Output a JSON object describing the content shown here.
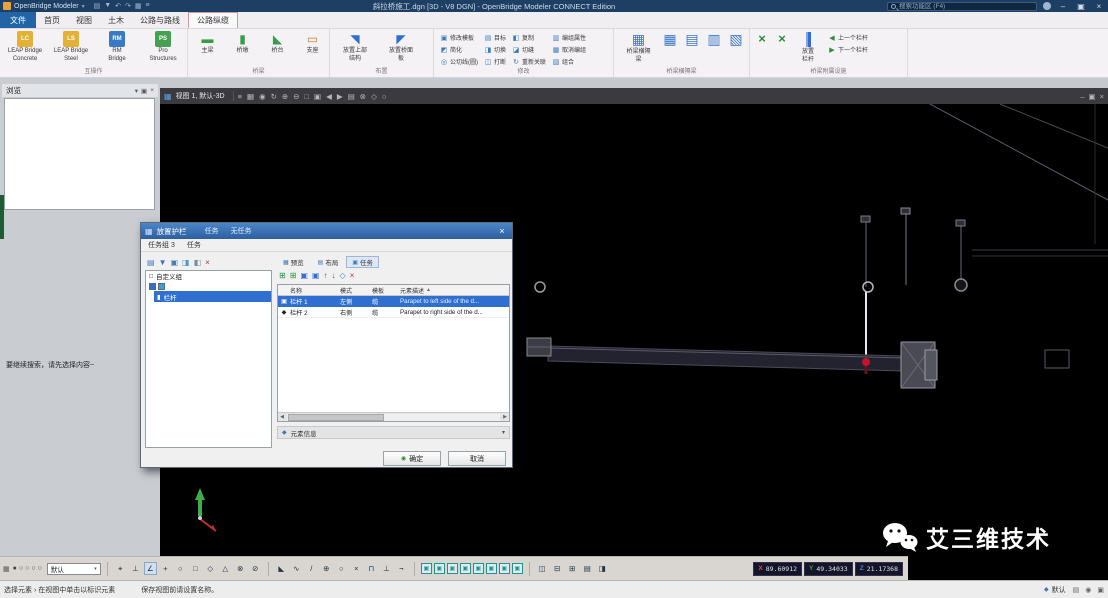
{
  "colors": {
    "titlebar": "#1d3f63",
    "selection": "#2e6fd0",
    "red_dot": "#c41228"
  },
  "titlebar": {
    "app_menu": "OpenBridge Modeler",
    "caret": "▾",
    "quick_icons": [
      "▤",
      "▼",
      "↶",
      "↷",
      "▦",
      "≡"
    ],
    "title": "斜拉桥施工.dgn [3D - V8 DGN] - OpenBridge Modeler CONNECT Edition",
    "search_placeholder": "搜索功能区 (F4)",
    "window_controls": [
      "–",
      "▣",
      "×"
    ]
  },
  "ribbon": {
    "file_tab": "文件",
    "tabs": [
      {
        "label": "首页",
        "active": false
      },
      {
        "label": "视图",
        "active": false
      },
      {
        "label": "土木",
        "active": false
      },
      {
        "label": "公路与路线",
        "active": false
      },
      {
        "label": "公路纵缆",
        "active": true
      }
    ],
    "interop": {
      "label": "互操作",
      "buttons": [
        {
          "badge": "LC",
          "line1": "LEAP Bridge",
          "line2": "Concrete",
          "color": "#e2b135"
        },
        {
          "badge": "LS",
          "line1": "LEAP Bridge",
          "line2": "Steel",
          "color": "#e2b135"
        },
        {
          "badge": "RM",
          "line1": "RM",
          "line2": "Bridge",
          "color": "#3a78c8"
        },
        {
          "badge": "PS",
          "line1": "Pro",
          "line2": "Structures",
          "color": "#46a052"
        }
      ]
    },
    "bridge": {
      "label": "桥梁",
      "buttons": [
        {
          "icon": "▬",
          "label": "主梁",
          "color": "#3a9c46"
        },
        {
          "icon": "▮",
          "label": "桥墩",
          "color": "#3a9c46"
        },
        {
          "icon": "◣",
          "label": "桥台",
          "color": "#3a9c46"
        },
        {
          "icon": "▭",
          "label": "支座",
          "color": "#c8842a"
        }
      ]
    },
    "place": {
      "label": "布置",
      "buttons": [
        {
          "icon": "◥",
          "line1": "放置上部",
          "line2": "结构",
          "color": "#2e6fd0"
        },
        {
          "icon": "◤",
          "line1": "放置桥面",
          "line2": "板",
          "color": "#2e6fd0"
        }
      ]
    },
    "modify": {
      "label": "修改",
      "cols": [
        [
          {
            "icon": "▣",
            "label": "修改模板"
          },
          {
            "icon": "◩",
            "label": "简化"
          },
          {
            "icon": "◎",
            "label": "公切线(圆)"
          }
        ],
        [
          {
            "icon": "▤",
            "label": "目标"
          },
          {
            "icon": "◨",
            "label": "切换"
          },
          {
            "icon": "◫",
            "label": "打断"
          }
        ],
        [
          {
            "icon": "◧",
            "label": "复制"
          },
          {
            "icon": "◪",
            "label": "切缝"
          },
          {
            "icon": "↻",
            "label": "重新关联"
          }
        ],
        [
          {
            "icon": "▥",
            "label": "编组属性"
          },
          {
            "icon": "▦",
            "label": "取消编组"
          },
          {
            "icon": "▧",
            "label": "组合"
          }
        ]
      ]
    },
    "diaphragm": {
      "label": "桥梁横隔梁",
      "icon": "▦",
      "button": {
        "line1": "桥梁横隔",
        "line2": "梁"
      },
      "icons": [
        "▦",
        "▤",
        "▥",
        "▧"
      ]
    },
    "accessory": {
      "label": "桥梁附属设施",
      "cut_icons": [
        "×",
        "×"
      ],
      "main": {
        "line1": "放置",
        "line2": "栏杆"
      },
      "items": [
        {
          "icon": "◀",
          "label": "上一个栏杆"
        },
        {
          "icon": "▶",
          "label": "下一个栏杆"
        }
      ]
    }
  },
  "view_window": {
    "menu_icon": "▦",
    "tab_label": "视图 1, 默认-3D",
    "toolbar_icons": [
      "≡",
      "▦",
      "◉",
      "↻",
      "⊕",
      "⊖",
      "□",
      "▣",
      "◀",
      "▶",
      "▤",
      "⊗",
      "◇",
      "○"
    ],
    "window_controls": [
      "–",
      "▣",
      "×"
    ]
  },
  "explorer": {
    "title": "浏览",
    "header_icons": [
      "▾",
      "▣",
      "×"
    ],
    "hint": "要继续搜索，请先选择内容~"
  },
  "dialog": {
    "icon": "▦",
    "title": "放置护栏",
    "menu_items": [
      "任务",
      "无任务"
    ],
    "close": "×",
    "menubar": [
      "任务组 3",
      "任务"
    ],
    "left_toolbar": [
      {
        "glyph": "▤",
        "color": "#4a7ab5"
      },
      {
        "glyph": "▼",
        "color": "#2e6fd0"
      },
      {
        "glyph": "▣",
        "color": "#4a7ab5"
      },
      {
        "glyph": "◨",
        "color": "#4a9ad0"
      },
      {
        "glyph": "◧",
        "color": "#7a8a9a"
      },
      {
        "glyph": "×",
        "color": "#c03030"
      }
    ],
    "tree": {
      "root_check": "□",
      "root": "自定义组",
      "swatches": [
        "#2e6fd0",
        "#36a0d8"
      ],
      "selected_icon": "▮",
      "selected": "栏杆"
    },
    "tabs": [
      {
        "icon": "▦",
        "label": "预览",
        "active": false
      },
      {
        "icon": "▤",
        "label": "布局",
        "active": false
      },
      {
        "icon": "▣",
        "label": "任务",
        "active": true
      }
    ],
    "right_toolbar": [
      {
        "glyph": "⊞",
        "color": "#2e8b3a"
      },
      {
        "glyph": "⊞",
        "color": "#2e8b3a"
      },
      {
        "glyph": "▣",
        "color": "#2e6fd0"
      },
      {
        "glyph": "▣",
        "color": "#2e6fd0"
      },
      {
        "glyph": "↑",
        "color": "#555555"
      },
      {
        "glyph": "↓",
        "color": "#555555"
      },
      {
        "glyph": "◇",
        "color": "#4a7ab5"
      },
      {
        "glyph": "×",
        "color": "#c03030"
      }
    ],
    "table": {
      "columns": [
        "名称",
        "模式",
        "模板",
        "元素描述"
      ],
      "sort": "▲",
      "rows": [
        {
          "marker": "▣",
          "name": "栏杆 1",
          "mode": "左侧",
          "template": "缆",
          "desc": "Parapet to left side of the d..."
        },
        {
          "marker": "◆",
          "name": "栏杆 2",
          "mode": "右侧",
          "template": "缆",
          "desc": "Parapet to right side of the d..."
        }
      ]
    },
    "scroll_left": "◀",
    "scroll_right": "▶",
    "info_icon": "◆",
    "info_bar": "元素信息",
    "info_chevron": "▾",
    "ok_icon": "◉",
    "buttons": [
      "确定",
      "取消"
    ]
  },
  "bottom_toolbar": {
    "grid_icon": "▦",
    "view_circles": [
      "●",
      "○",
      "○",
      "○",
      "○"
    ],
    "style_value": "默认",
    "style_caret": "▾",
    "snap_icons": [
      {
        "glyph": "⌖",
        "active": false
      },
      {
        "glyph": "⊥",
        "active": false
      },
      {
        "glyph": "∠",
        "active": true
      },
      {
        "glyph": "+",
        "active": false
      },
      {
        "glyph": "○",
        "active": false
      },
      {
        "glyph": "□",
        "active": false
      },
      {
        "glyph": "◇",
        "active": false
      },
      {
        "glyph": "△",
        "active": false
      },
      {
        "glyph": "⊗",
        "active": false
      },
      {
        "glyph": "⊘",
        "active": false
      }
    ],
    "tool_icons": [
      "◣",
      "∿",
      "/",
      "⊕",
      "○",
      "×",
      "⊓",
      "⊥",
      "¬"
    ],
    "window_icons": [
      "▣",
      "▣",
      "▣",
      "▣",
      "▣",
      "▣",
      "▣",
      "▣"
    ],
    "extra_icons": [
      "◫",
      "⊟",
      "⊞",
      "▤",
      "◨"
    ],
    "coords": [
      {
        "axis": "X",
        "value": "89.60912",
        "color": "#d05050"
      },
      {
        "axis": "Y",
        "value": "49.34033",
        "color": "#4a9a4a"
      },
      {
        "axis": "Z",
        "value": "21.17368",
        "color": "#5a82d0"
      }
    ]
  },
  "statusbar": {
    "tool": "选择元素 › 在视图中单击以标识元素",
    "prompt": "保存视图前请设置名称。",
    "mode_icon": "◆",
    "mode": "默认",
    "right_icons": [
      "▤",
      "◉",
      "▣"
    ]
  },
  "watermark": {
    "text": "艾三维技术"
  }
}
